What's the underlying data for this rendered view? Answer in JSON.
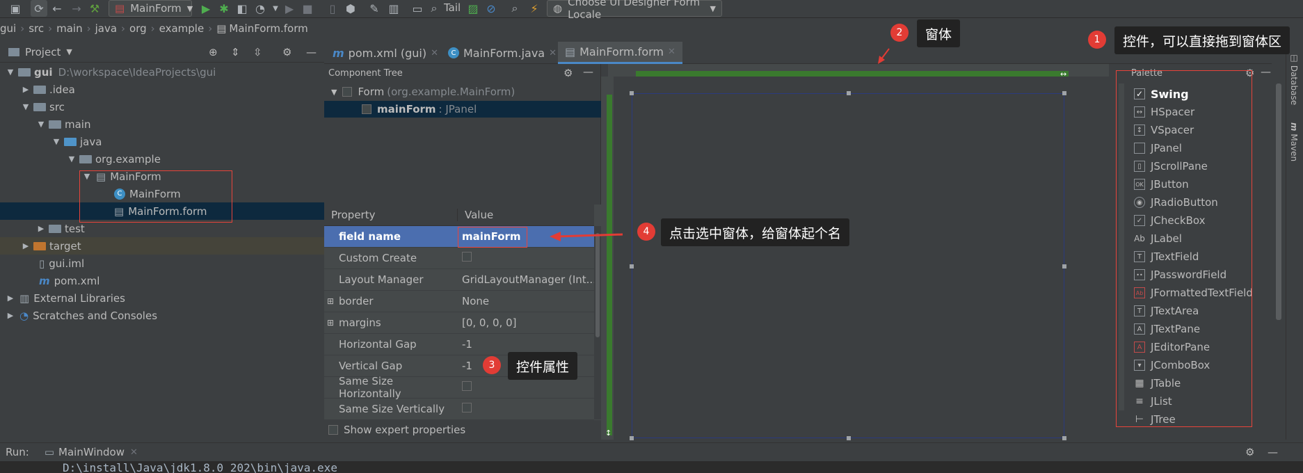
{
  "toolbar": {
    "run_config": "MainForm",
    "tail_label": "Tail",
    "locale_combo": "Choose UI Designer Form Locale"
  },
  "breadcrumb": [
    "gui",
    "src",
    "main",
    "java",
    "org",
    "example",
    "MainForm.form"
  ],
  "project_panel": {
    "title": "Project",
    "items": [
      {
        "label": "gui",
        "path": "D:\\workspace\\IdeaProjects\\gui"
      },
      {
        "label": ".idea"
      },
      {
        "label": "src"
      },
      {
        "label": "main"
      },
      {
        "label": "java"
      },
      {
        "label": "org.example"
      },
      {
        "label": "MainForm"
      },
      {
        "label": "MainForm"
      },
      {
        "label": "MainForm.form"
      },
      {
        "label": "test"
      },
      {
        "label": "target"
      },
      {
        "label": "gui.iml"
      },
      {
        "label": "pom.xml"
      },
      {
        "label": "External Libraries"
      },
      {
        "label": "Scratches and Consoles"
      }
    ]
  },
  "tabs": [
    {
      "label": "pom.xml (gui)"
    },
    {
      "label": "MainForm.java"
    },
    {
      "label": "MainForm.form"
    }
  ],
  "component_tree": {
    "title": "Component Tree",
    "form_label": "Form",
    "form_class": "(org.example.MainForm)",
    "child_name": "mainForm",
    "child_type": ": JPanel"
  },
  "properties": {
    "col_property": "Property",
    "col_value": "Value",
    "rows": [
      {
        "name": "field name",
        "value": "mainForm"
      },
      {
        "name": "Custom Create",
        "value": ""
      },
      {
        "name": "Layout Manager",
        "value": "GridLayoutManager (Int..."
      },
      {
        "name": "border",
        "value": "None"
      },
      {
        "name": "margins",
        "value": "[0, 0, 0, 0]"
      },
      {
        "name": "Horizontal Gap",
        "value": "-1"
      },
      {
        "name": "Vertical Gap",
        "value": "-1"
      },
      {
        "name": "Same Size Horizontally",
        "value": ""
      },
      {
        "name": "Same Size Vertically",
        "value": ""
      }
    ],
    "show_expert": "Show expert properties"
  },
  "palette": {
    "title": "Palette",
    "group": "Swing",
    "items": [
      {
        "label": "HSpacer",
        "glyph": "↔"
      },
      {
        "label": "VSpacer",
        "glyph": "↕"
      },
      {
        "label": "JPanel",
        "glyph": ""
      },
      {
        "label": "JScrollPane",
        "glyph": "▯"
      },
      {
        "label": "JButton",
        "glyph": "OK"
      },
      {
        "label": "JRadioButton",
        "glyph": "◉"
      },
      {
        "label": "JCheckBox",
        "glyph": "✓"
      },
      {
        "label": "JLabel",
        "glyph": "Ab"
      },
      {
        "label": "JTextField",
        "glyph": "T"
      },
      {
        "label": "JPasswordField",
        "glyph": "••"
      },
      {
        "label": "JFormattedTextField",
        "glyph": "Ab"
      },
      {
        "label": "JTextArea",
        "glyph": "T"
      },
      {
        "label": "JTextPane",
        "glyph": "A"
      },
      {
        "label": "JEditorPane",
        "glyph": "A"
      },
      {
        "label": "JComboBox",
        "glyph": "▾"
      },
      {
        "label": "JTable",
        "glyph": "▦"
      },
      {
        "label": "JList",
        "glyph": "≡"
      },
      {
        "label": "JTree",
        "glyph": "⊢"
      }
    ]
  },
  "right_strip": [
    "Database",
    "Maven"
  ],
  "run_bar": {
    "label": "Run:",
    "tab": "MainWindow"
  },
  "console_text": "D:\\install\\Java\\jdk1.8.0_202\\bin\\java.exe",
  "annotations": [
    {
      "num": "1",
      "text": "控件，可以直接拖到窗体区"
    },
    {
      "num": "2",
      "text": "窗体"
    },
    {
      "num": "3",
      "text": "控件属性"
    },
    {
      "num": "4",
      "text": "点击选中窗体，给窗体起个名"
    }
  ],
  "colors": {
    "accent_red": "#e23c35",
    "selection_blue": "#4b6eaf",
    "tree_selection": "#0d293e",
    "green_bar": "#3a7a2e"
  }
}
